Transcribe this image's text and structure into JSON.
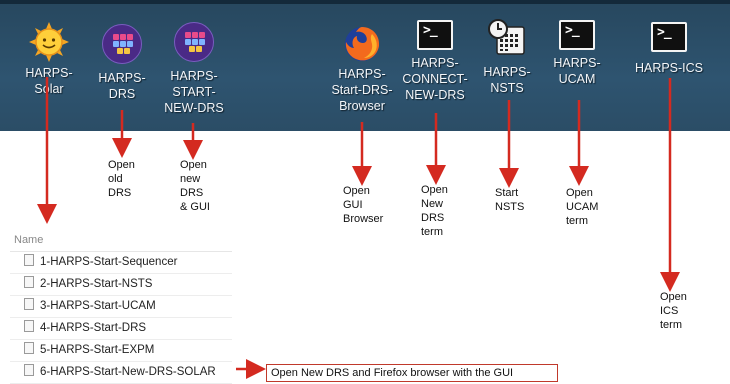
{
  "desktop_icons": [
    {
      "id": "harps-solar",
      "label": "HARPS-\nSolar",
      "icon": "sun-icon"
    },
    {
      "id": "harps-drs",
      "label": "HARPS-\nDRS",
      "icon": "drs-app-icon"
    },
    {
      "id": "harps-start-new-drs",
      "label": "HARPS-\nSTART-\nNEW-DRS",
      "icon": "drs-app-icon"
    },
    {
      "id": "harps-start-drs-browser",
      "label": "HARPS-\nStart-DRS-\nBrowser",
      "icon": "firefox-icon"
    },
    {
      "id": "harps-connect-new-drs",
      "label": "HARPS-\nCONNECT-\nNEW-DRS",
      "icon": "terminal-icon"
    },
    {
      "id": "harps-nsts",
      "label": "HARPS-\nNSTS",
      "icon": "clock-calendar-icon"
    },
    {
      "id": "harps-ucam",
      "label": "HARPS-\nUCAM",
      "icon": "terminal-icon"
    },
    {
      "id": "harps-ics",
      "label": "HARPS-ICS",
      "icon": "terminal-icon"
    }
  ],
  "annotations": [
    {
      "id": "old-drs",
      "text": "Open\nold\nDRS"
    },
    {
      "id": "new-drs-gui",
      "text": "Open\nnew\nDRS\n& GUI"
    },
    {
      "id": "gui-browser",
      "text": "Open\nGUI\nBrowser"
    },
    {
      "id": "new-drs-term",
      "text": "Open\nNew\nDRS\nterm"
    },
    {
      "id": "start-nsts",
      "text": "Start\nNSTS"
    },
    {
      "id": "ucam-term",
      "text": "Open\nUCAM\nterm"
    },
    {
      "id": "ics-term",
      "text": "Open\nICS\nterm"
    }
  ],
  "file_list": {
    "header": "Name",
    "items": [
      "1-HARPS-Start-Sequencer",
      "2-HARPS-Start-NSTS",
      "3-HARPS-Start-UCAM",
      "4-HARPS-Start-DRS",
      "5-HARPS-Start-EXPM",
      "6-HARPS-Start-New-DRS-SOLAR"
    ]
  },
  "callout": "Open New DRS and Firefox browser with the GUI",
  "colors": {
    "desktop_bg": "#2e5470",
    "arrow": "#d42a20"
  }
}
